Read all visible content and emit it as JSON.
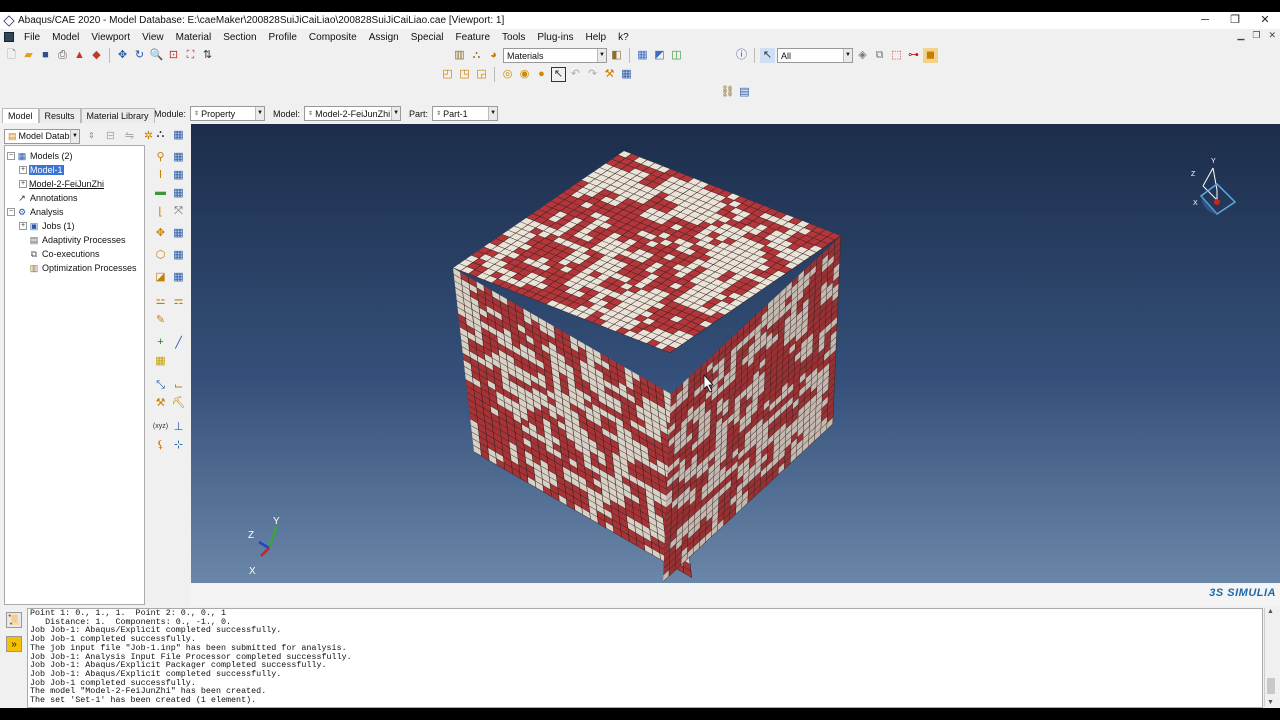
{
  "window": {
    "title": "Abaqus/CAE 2020 - Model Database: E:\\caeMaker\\200828SuiJiCaiLiao\\200828SuiJiCaiLiao.cae [Viewport: 1]",
    "minimize": "─",
    "restore": "❐",
    "close": "✕"
  },
  "menu": [
    "File",
    "Model",
    "Viewport",
    "View",
    "Material",
    "Section",
    "Profile",
    "Composite",
    "Assign",
    "Special",
    "Feature",
    "Tools",
    "Plug-ins",
    "Help",
    "k?"
  ],
  "toolbar": {
    "materials_combo": "Materials",
    "selection_filter": "All"
  },
  "context": {
    "module_label": "Module:",
    "module_value": "Property",
    "model_label": "Model:",
    "model_value": "Model-2-FeiJunZhi",
    "part_label": "Part:",
    "part_value": "Part-1"
  },
  "tabs": [
    "Model",
    "Results",
    "Material Library"
  ],
  "tree_combo": "Model Database",
  "tree": [
    {
      "label": "Models (2)",
      "indent": 0,
      "expander": "−",
      "icon": "models-icon",
      "style": ""
    },
    {
      "label": "Model-1",
      "indent": 1,
      "expander": "+",
      "icon": "",
      "style": "sel"
    },
    {
      "label": "Model-2-FeiJunZhi",
      "indent": 1,
      "expander": "+",
      "icon": "",
      "style": "und"
    },
    {
      "label": "Annotations",
      "indent": 0,
      "expander": "",
      "icon": "annotations-icon",
      "style": ""
    },
    {
      "label": "Analysis",
      "indent": 0,
      "expander": "−",
      "icon": "analysis-icon",
      "style": ""
    },
    {
      "label": "Jobs (1)",
      "indent": 1,
      "expander": "+",
      "icon": "jobs-icon",
      "style": ""
    },
    {
      "label": "Adaptivity Processes",
      "indent": 1,
      "expander": "",
      "icon": "adaptivity-icon",
      "style": ""
    },
    {
      "label": "Co-executions",
      "indent": 1,
      "expander": "",
      "icon": "coexec-icon",
      "style": ""
    },
    {
      "label": "Optimization Processes",
      "indent": 1,
      "expander": "",
      "icon": "optimization-icon",
      "style": ""
    }
  ],
  "triad_viewport": {
    "x": "X",
    "y": "Y",
    "z": "Z"
  },
  "triad_view": {
    "x": "X",
    "y": "Y",
    "z": "Z"
  },
  "simulia": "3S SIMULIA",
  "messages": [
    "Point 1: 0., 1., 1.  Point 2: 0., 0., 1",
    "   Distance: 1.  Components: 0., -1., 0.",
    "Job Job-1: Abaqus/Explicit completed successfully.",
    "Job Job-1 completed successfully.",
    "The job input file \"Job-1.inp\" has been submitted for analysis.",
    "Job Job-1: Analysis Input File Processor completed successfully.",
    "Job Job-1: Abaqus/Explicit Packager completed successfully.",
    "Job Job-1: Abaqus/Explicit completed successfully.",
    "Job Job-1 completed successfully.",
    "The model \"Model-2-FeiJunZhi\" has been created.",
    "The set 'Set-1' has been created (1 element)."
  ],
  "colors": {
    "red_element": "#b3363a",
    "white_element": "#eae4d8",
    "selection_blue": "#3875d7",
    "viewport_top": "#1c2d4a",
    "viewport_bottom": "#6a86a8"
  }
}
